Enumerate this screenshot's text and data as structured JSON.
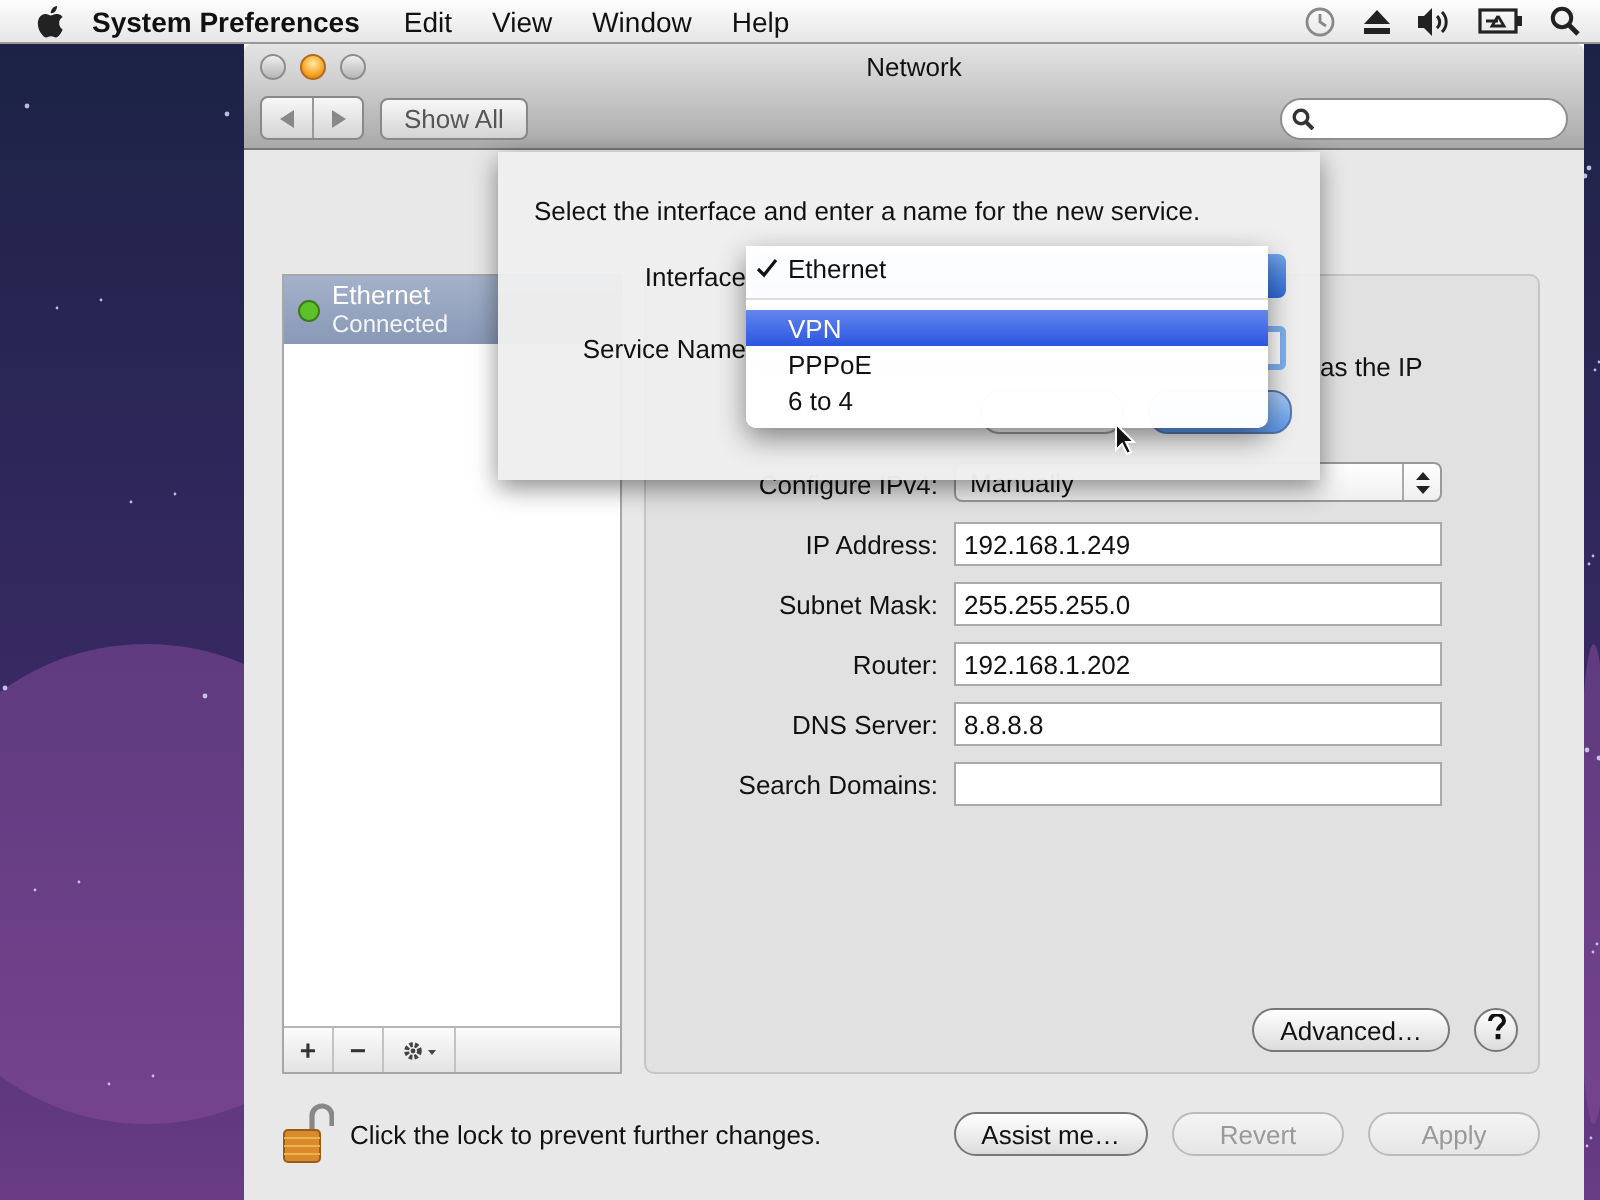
{
  "menu_bar": {
    "app_name": "System Preferences",
    "menus": [
      "Edit",
      "View",
      "Window",
      "Help"
    ]
  },
  "window": {
    "title": "Network",
    "toolbar": {
      "show_all": "Show All"
    }
  },
  "services": [
    {
      "name": "Ethernet",
      "status": "Connected",
      "selected": true,
      "color": "#5cc22a"
    }
  ],
  "sidebar_tools": [
    "+",
    "−"
  ],
  "panel": {
    "note": "as the IP",
    "fields": [
      {
        "label": "Configure IPv4:",
        "value": "Manually",
        "kind": "popup"
      },
      {
        "label": "IP Address:",
        "value": "192.168.1.249",
        "kind": "text"
      },
      {
        "label": "Subnet Mask:",
        "value": "255.255.255.0",
        "kind": "text"
      },
      {
        "label": "Router:",
        "value": "192.168.1.202",
        "kind": "text"
      },
      {
        "label": "DNS Server:",
        "value": "8.8.8.8",
        "kind": "text"
      },
      {
        "label": "Search Domains:",
        "kind": "text"
      }
    ],
    "advanced": "Advanced…"
  },
  "sheet": {
    "instruction": "Select the interface and enter a name for the new service.",
    "interface_label": "Interface",
    "service_name_label": "Service Name"
  },
  "interface_menu": [
    {
      "kind": "item",
      "label": "Ethernet",
      "checked": true,
      "selected": false
    },
    {
      "kind": "separator"
    },
    {
      "kind": "item",
      "label": "VPN",
      "checked": false,
      "selected": true
    },
    {
      "kind": "item",
      "label": "PPPoE",
      "checked": false,
      "selected": false
    },
    {
      "kind": "item",
      "label": "6 to 4",
      "checked": false,
      "selected": false
    }
  ],
  "footer": {
    "lock_text": "Click the lock to prevent further changes.",
    "buttons": [
      {
        "label": "Assist me…",
        "disabled": false
      },
      {
        "label": "Revert",
        "disabled": true
      },
      {
        "label": "Apply",
        "disabled": true
      }
    ]
  }
}
